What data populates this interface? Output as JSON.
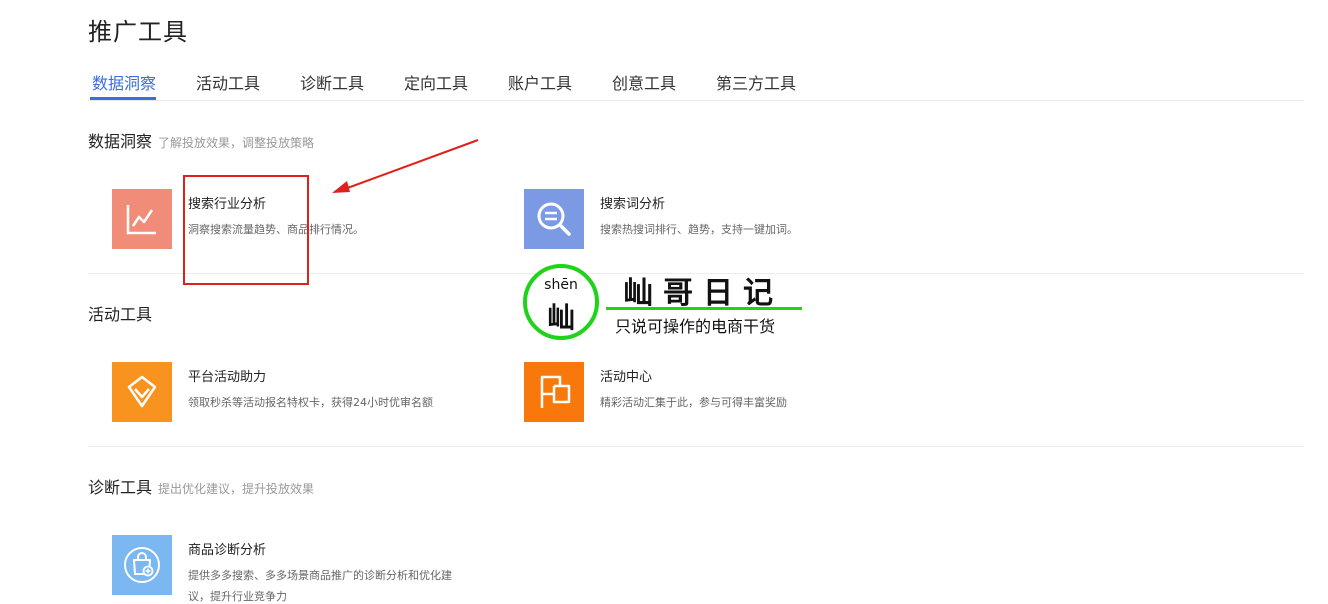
{
  "page": {
    "title": "推广工具"
  },
  "tabs": [
    {
      "label": "数据洞察",
      "active": true
    },
    {
      "label": "活动工具"
    },
    {
      "label": "诊断工具"
    },
    {
      "label": "定向工具"
    },
    {
      "label": "账户工具"
    },
    {
      "label": "创意工具"
    },
    {
      "label": "第三方工具"
    }
  ],
  "sections": {
    "insight": {
      "title": "数据洞察",
      "desc": "了解投放效果，调整投放策略",
      "tools": [
        {
          "name": "搜索行业分析",
          "desc": "洞察搜索流量趋势、商品排行情况。",
          "icon": "trend-chart-icon",
          "color": "#f08c77"
        },
        {
          "name": "搜索词分析",
          "desc": "搜索热搜词排行、趋势，支持一键加词。",
          "icon": "search-list-icon",
          "color": "#7b9ae3"
        }
      ]
    },
    "activity": {
      "title": "活动工具",
      "desc": "",
      "tools": [
        {
          "name": "平台活动助力",
          "desc": "领取秒杀等活动报名特权卡，获得24小时优审名额",
          "icon": "diamond-icon",
          "color": "#f89320"
        },
        {
          "name": "活动中心",
          "desc": "精彩活动汇集于此，参与可得丰富奖励",
          "icon": "flag-icon",
          "color": "#f8780c"
        }
      ]
    },
    "diagnosis": {
      "title": "诊断工具",
      "desc": "提出优化建议，提升投放效果",
      "tools": [
        {
          "name": "商品诊断分析",
          "desc": "提供多多搜索、多多场景商品推广的诊断分析和优化建议，提升行业竞争力",
          "icon": "shopping-bag-plus-icon",
          "color": "#7bb8f1"
        }
      ]
    }
  },
  "watermark": {
    "pinyin": "shēn",
    "char": "屾",
    "title": "屾哥日记",
    "slogan": "只说可操作的电商干货",
    "accent": "#1ed31a"
  },
  "annotation": {
    "color": "#e0201b"
  },
  "colors": {
    "accent": "#3b6ed9"
  }
}
